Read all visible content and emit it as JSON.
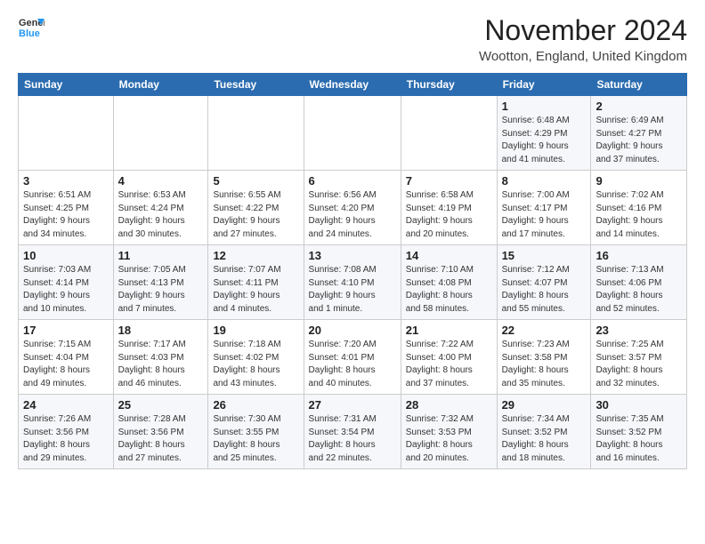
{
  "header": {
    "logo_line1": "General",
    "logo_line2": "Blue",
    "month_title": "November 2024",
    "location": "Wootton, England, United Kingdom"
  },
  "weekdays": [
    "Sunday",
    "Monday",
    "Tuesday",
    "Wednesday",
    "Thursday",
    "Friday",
    "Saturday"
  ],
  "weeks": [
    [
      {
        "day": "",
        "info": ""
      },
      {
        "day": "",
        "info": ""
      },
      {
        "day": "",
        "info": ""
      },
      {
        "day": "",
        "info": ""
      },
      {
        "day": "",
        "info": ""
      },
      {
        "day": "1",
        "info": "Sunrise: 6:48 AM\nSunset: 4:29 PM\nDaylight: 9 hours\nand 41 minutes."
      },
      {
        "day": "2",
        "info": "Sunrise: 6:49 AM\nSunset: 4:27 PM\nDaylight: 9 hours\nand 37 minutes."
      }
    ],
    [
      {
        "day": "3",
        "info": "Sunrise: 6:51 AM\nSunset: 4:25 PM\nDaylight: 9 hours\nand 34 minutes."
      },
      {
        "day": "4",
        "info": "Sunrise: 6:53 AM\nSunset: 4:24 PM\nDaylight: 9 hours\nand 30 minutes."
      },
      {
        "day": "5",
        "info": "Sunrise: 6:55 AM\nSunset: 4:22 PM\nDaylight: 9 hours\nand 27 minutes."
      },
      {
        "day": "6",
        "info": "Sunrise: 6:56 AM\nSunset: 4:20 PM\nDaylight: 9 hours\nand 24 minutes."
      },
      {
        "day": "7",
        "info": "Sunrise: 6:58 AM\nSunset: 4:19 PM\nDaylight: 9 hours\nand 20 minutes."
      },
      {
        "day": "8",
        "info": "Sunrise: 7:00 AM\nSunset: 4:17 PM\nDaylight: 9 hours\nand 17 minutes."
      },
      {
        "day": "9",
        "info": "Sunrise: 7:02 AM\nSunset: 4:16 PM\nDaylight: 9 hours\nand 14 minutes."
      }
    ],
    [
      {
        "day": "10",
        "info": "Sunrise: 7:03 AM\nSunset: 4:14 PM\nDaylight: 9 hours\nand 10 minutes."
      },
      {
        "day": "11",
        "info": "Sunrise: 7:05 AM\nSunset: 4:13 PM\nDaylight: 9 hours\nand 7 minutes."
      },
      {
        "day": "12",
        "info": "Sunrise: 7:07 AM\nSunset: 4:11 PM\nDaylight: 9 hours\nand 4 minutes."
      },
      {
        "day": "13",
        "info": "Sunrise: 7:08 AM\nSunset: 4:10 PM\nDaylight: 9 hours\nand 1 minute."
      },
      {
        "day": "14",
        "info": "Sunrise: 7:10 AM\nSunset: 4:08 PM\nDaylight: 8 hours\nand 58 minutes."
      },
      {
        "day": "15",
        "info": "Sunrise: 7:12 AM\nSunset: 4:07 PM\nDaylight: 8 hours\nand 55 minutes."
      },
      {
        "day": "16",
        "info": "Sunrise: 7:13 AM\nSunset: 4:06 PM\nDaylight: 8 hours\nand 52 minutes."
      }
    ],
    [
      {
        "day": "17",
        "info": "Sunrise: 7:15 AM\nSunset: 4:04 PM\nDaylight: 8 hours\nand 49 minutes."
      },
      {
        "day": "18",
        "info": "Sunrise: 7:17 AM\nSunset: 4:03 PM\nDaylight: 8 hours\nand 46 minutes."
      },
      {
        "day": "19",
        "info": "Sunrise: 7:18 AM\nSunset: 4:02 PM\nDaylight: 8 hours\nand 43 minutes."
      },
      {
        "day": "20",
        "info": "Sunrise: 7:20 AM\nSunset: 4:01 PM\nDaylight: 8 hours\nand 40 minutes."
      },
      {
        "day": "21",
        "info": "Sunrise: 7:22 AM\nSunset: 4:00 PM\nDaylight: 8 hours\nand 37 minutes."
      },
      {
        "day": "22",
        "info": "Sunrise: 7:23 AM\nSunset: 3:58 PM\nDaylight: 8 hours\nand 35 minutes."
      },
      {
        "day": "23",
        "info": "Sunrise: 7:25 AM\nSunset: 3:57 PM\nDaylight: 8 hours\nand 32 minutes."
      }
    ],
    [
      {
        "day": "24",
        "info": "Sunrise: 7:26 AM\nSunset: 3:56 PM\nDaylight: 8 hours\nand 29 minutes."
      },
      {
        "day": "25",
        "info": "Sunrise: 7:28 AM\nSunset: 3:56 PM\nDaylight: 8 hours\nand 27 minutes."
      },
      {
        "day": "26",
        "info": "Sunrise: 7:30 AM\nSunset: 3:55 PM\nDaylight: 8 hours\nand 25 minutes."
      },
      {
        "day": "27",
        "info": "Sunrise: 7:31 AM\nSunset: 3:54 PM\nDaylight: 8 hours\nand 22 minutes."
      },
      {
        "day": "28",
        "info": "Sunrise: 7:32 AM\nSunset: 3:53 PM\nDaylight: 8 hours\nand 20 minutes."
      },
      {
        "day": "29",
        "info": "Sunrise: 7:34 AM\nSunset: 3:52 PM\nDaylight: 8 hours\nand 18 minutes."
      },
      {
        "day": "30",
        "info": "Sunrise: 7:35 AM\nSunset: 3:52 PM\nDaylight: 8 hours\nand 16 minutes."
      }
    ]
  ]
}
